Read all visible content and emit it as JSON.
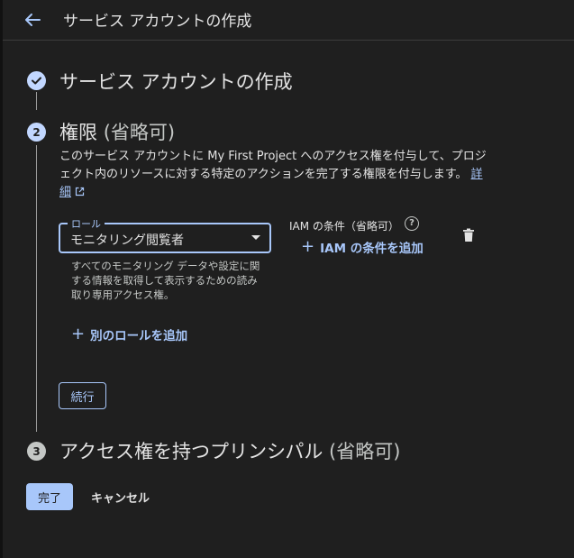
{
  "header": {
    "title": "サービス アカウントの作成"
  },
  "steps": {
    "step1": {
      "title": "サービス アカウントの作成"
    },
    "step2": {
      "number": "2",
      "title": "権限",
      "optional": "(省略可)",
      "description": "このサービス アカウントに My First Project へのアクセス権を付与して、プロジェクト内のリソースに対する特定のアクションを完了する権限を付与します。",
      "details_link": "詳細"
    },
    "step3": {
      "number": "3",
      "title": "アクセス権を持つプリンシパル",
      "optional": "(省略可)"
    }
  },
  "role": {
    "label": "ロール",
    "value": "モニタリング閲覧者",
    "help": "すべてのモニタリング データや設定に関する情報を取得して表示するための読み取り専用アクセス権。"
  },
  "iam_condition": {
    "label": "IAM の条件（省略可）",
    "help_icon": "?",
    "add_label": "IAM の条件を追加"
  },
  "add_role_label": "別のロールを追加",
  "buttons": {
    "continue": "続行",
    "done": "完了",
    "cancel": "キャンセル"
  },
  "icons": {
    "plus": "+"
  },
  "colors": {
    "accent": "#a8c7fa",
    "background": "#1f1f1f",
    "text": "#e3e3e3"
  }
}
